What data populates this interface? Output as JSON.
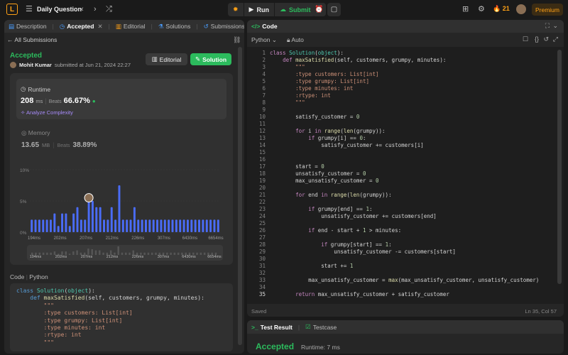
{
  "topbar": {
    "title": "Daily Question",
    "run": "Run",
    "submit": "Submit",
    "streak": "21",
    "premium": "Premium"
  },
  "left_tabs": [
    "Description",
    "Accepted",
    "Editorial",
    "Solutions",
    "Submissions"
  ],
  "back_label": "All Submissions",
  "result": {
    "status": "Accepted",
    "user": "Mohit Kumar",
    "submitted": "submitted at Jun 21, 2024 22:27",
    "editorial_btn": "Editorial",
    "solution_btn": "Solution"
  },
  "runtime": {
    "label": "Runtime",
    "value": "208",
    "unit": "ms",
    "beats_label": "Beats",
    "beats": "66.67%",
    "analyze": "Analyze Complexity"
  },
  "memory": {
    "label": "Memory",
    "value": "13.65",
    "unit": "MB",
    "beats_label": "Beats",
    "beats": "38.89%"
  },
  "chart_data": {
    "type": "bar",
    "yticks": [
      "10%",
      "5%",
      "0%"
    ],
    "ylim": [
      0,
      10
    ],
    "xlabels": [
      "194ms",
      "202ms",
      "207ms",
      "212ms",
      "226ms",
      "307ms",
      "6430ms",
      "6654ms"
    ],
    "values": [
      2,
      2,
      2,
      2,
      2,
      2,
      3,
      1,
      3,
      3,
      1,
      3,
      4,
      2,
      2,
      5.5,
      5,
      4,
      4,
      2,
      2,
      4,
      2,
      7.5,
      2,
      2,
      2,
      4,
      2,
      2,
      2,
      2,
      2,
      2,
      2,
      2,
      2,
      2,
      2,
      2,
      2,
      2,
      2,
      2,
      2,
      2,
      2,
      2,
      2,
      2
    ],
    "highlight_index": 15
  },
  "code_section": {
    "label": "Code",
    "lang": "Python"
  },
  "editor": {
    "title": "Code",
    "lang": "Python",
    "mode": "Auto",
    "status": "Saved",
    "cursor": "Ln 35, Col 57",
    "lines": [
      "class Solution(object):",
      "    def maxSatisfied(self, customers, grumpy, minutes):",
      "        \"\"\"",
      "        :type customers: List[int]",
      "        :type grumpy: List[int]",
      "        :type minutes: int",
      "        :rtype: int",
      "        \"\"\"",
      "",
      "        satisfy_customer = 0",
      "",
      "        for i in range(len(grumpy)):",
      "            if grumpy[i] == 0:",
      "                satisfy_customer += customers[i]",
      "",
      "",
      "        start = 0",
      "        unsatisfy_customer = 0",
      "        max_unsatisfy_customer = 0",
      "",
      "        for end in range(len(grumpy)):",
      "",
      "            if grumpy[end] == 1:",
      "                unsatisfy_customer += customers[end]",
      "",
      "            if end - start + 1 > minutes:",
      "",
      "                if grumpy[start] == 1:",
      "                    unsatisfy_customer -= customers[start]",
      "",
      "                start += 1",
      "",
      "            max_unsatisfy_customer = max(max_unsatisfy_customer, unsatisfy_customer)",
      "",
      "        return max_unsatisfy_customer + satisfy_customer"
    ]
  },
  "bottom": {
    "tab1": "Test Result",
    "tab2": "Testcase",
    "status": "Accepted",
    "runtime": "Runtime: 7 ms"
  }
}
